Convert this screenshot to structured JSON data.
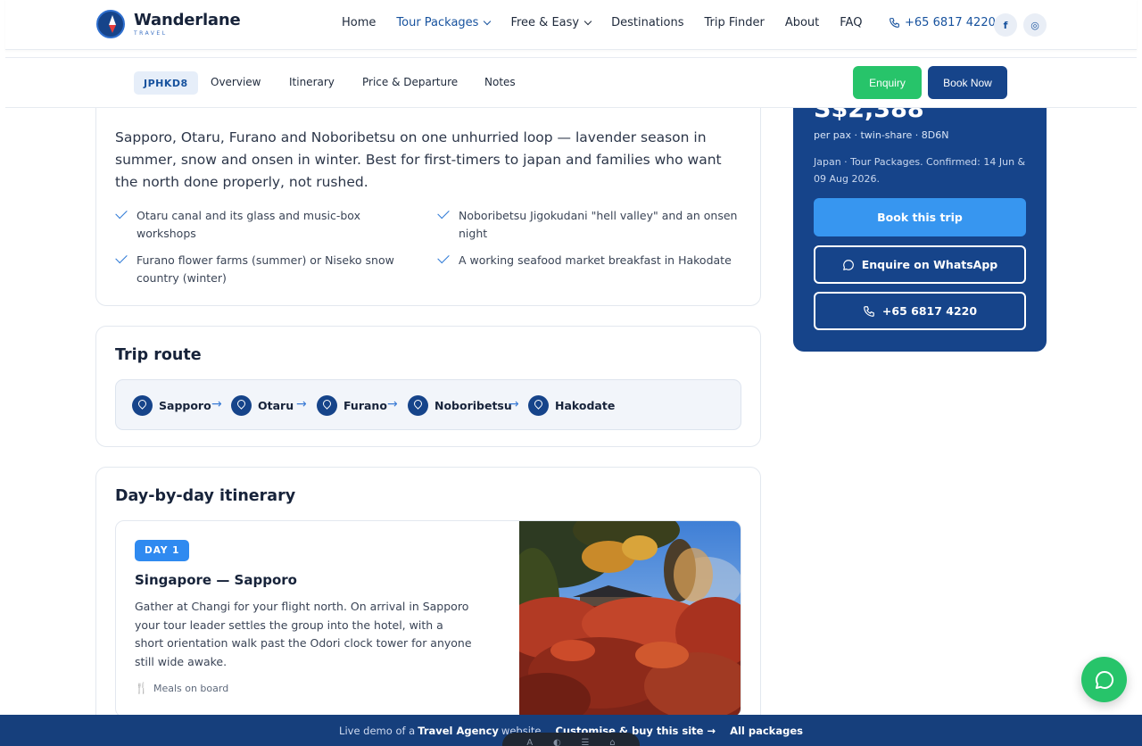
{
  "brand": {
    "name": "Wanderlane",
    "tagline": "TRAVEL"
  },
  "nav": {
    "items": [
      {
        "label": "Home"
      },
      {
        "label": "Tour Packages"
      },
      {
        "label": "Free & Easy"
      },
      {
        "label": "Destinations"
      },
      {
        "label": "Trip Finder"
      },
      {
        "label": "About"
      },
      {
        "label": "FAQ"
      }
    ],
    "phone": "+65 6817 4220",
    "social": {
      "facebook": "f",
      "instagram": "◎"
    }
  },
  "subnav": {
    "code": "JPHKD8",
    "tabs": [
      "Overview",
      "Itinerary",
      "Price & Departure",
      "Notes"
    ],
    "enquiry": "Enquiry",
    "book_now": "Book Now"
  },
  "intro": {
    "text": "Sapporo, Otaru, Furano and Noboribetsu on one unhurried loop — lavender season in summer, snow and onsen in winter. Best for first-timers to japan and families who want the north done properly, not rushed.",
    "highlights": [
      "Otaru canal and its glass and music-box workshops",
      "Noboribetsu Jigokudani \"hell valley\" and an onsen night",
      "Furano flower farms (summer) or Niseko snow country (winter)",
      "A working seafood market breakfast in Hakodate"
    ]
  },
  "route": {
    "title": "Trip route",
    "stops": [
      "Sapporo",
      "Otaru",
      "Furano",
      "Noboribetsu",
      "Hakodate"
    ]
  },
  "itinerary": {
    "title": "Day-by-day itinerary",
    "days": [
      {
        "badge": "DAY 1",
        "title": "Singapore — Sapporo",
        "description": "Gather at Changi for your flight north. On arrival in Sapporo your tour leader settles the group into the hotel, with a short orientation walk past the Odori clock tower for anyone still wide awake.",
        "meals": "Meals on board"
      }
    ]
  },
  "price": {
    "amount": "S$2,388",
    "basis": "per pax · twin-share · 8D6N",
    "confirmed": "Japan · Tour Packages. Confirmed: 14 Jun & 09 Aug 2026.",
    "book_trip": "Book this trip",
    "whatsapp": "Enquire on WhatsApp",
    "phone": "+65 6817 4220"
  },
  "footer": {
    "live_demo": "Live demo of a",
    "site_type": "Travel Agency",
    "website": "website",
    "customise": "Customise & buy this site →",
    "all_packages": "All packages"
  },
  "colors": {
    "primary": "#16448a",
    "accent": "#3796f0",
    "success": "#27c46a",
    "demo_bar": "#163f7c"
  }
}
